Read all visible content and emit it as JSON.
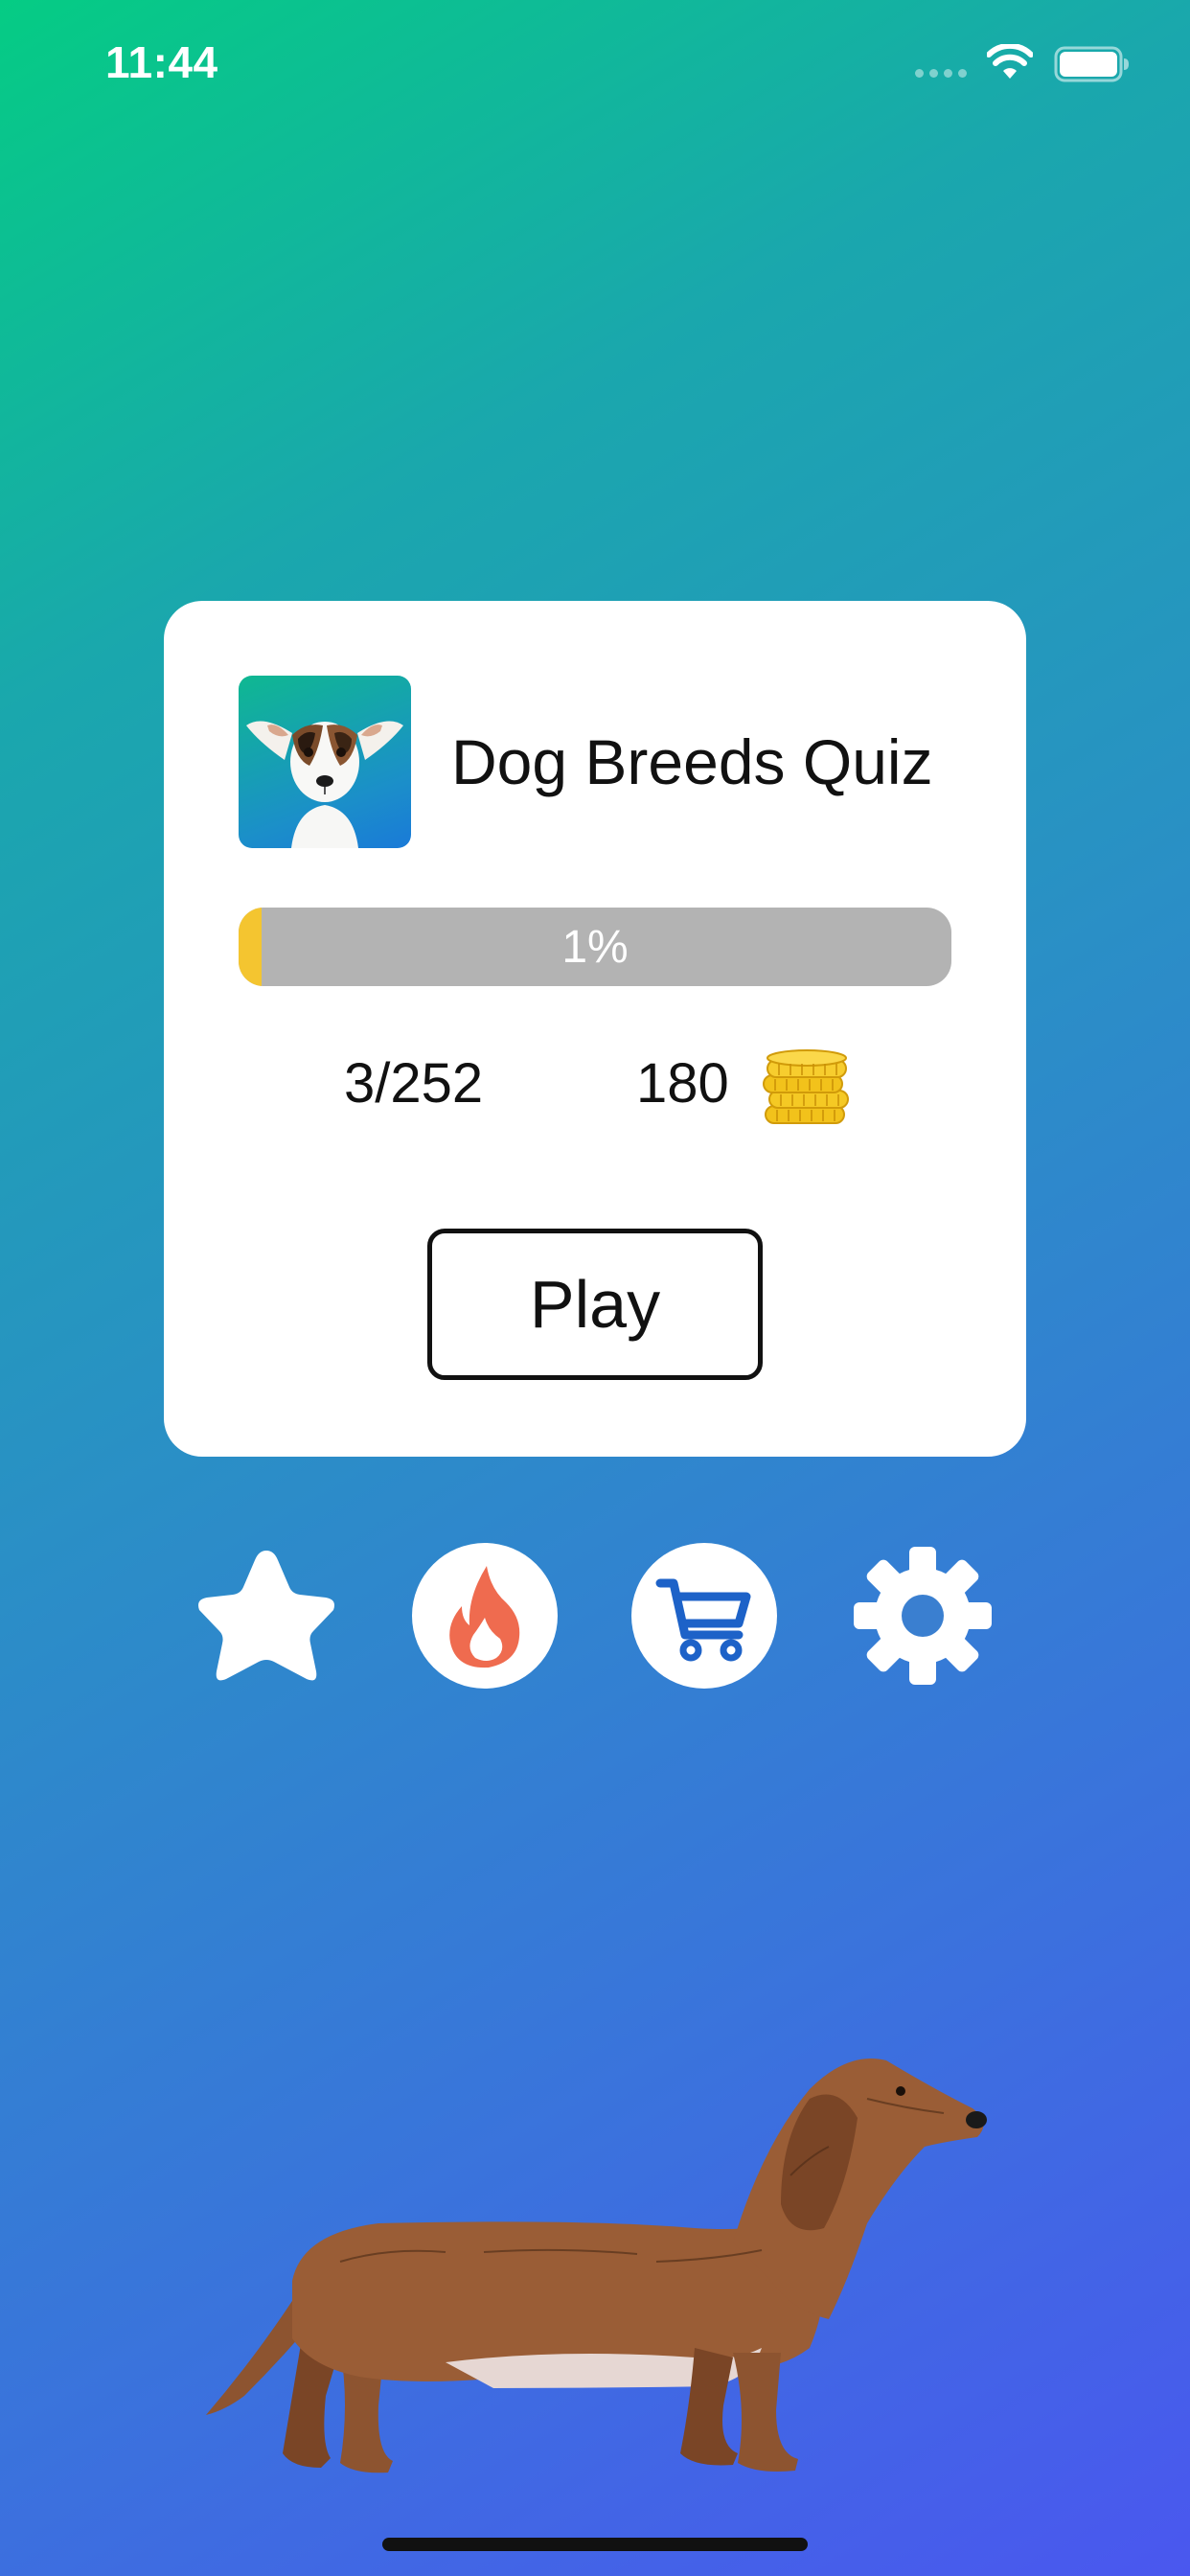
{
  "status_bar": {
    "time": "11:44"
  },
  "card": {
    "title": "Dog Breeds Quiz",
    "progress": {
      "label": "1%",
      "fraction": 0.01
    },
    "answered_count": "3/252",
    "coins": "180",
    "play_label": "Play"
  },
  "icons": {
    "app_icon": "dog-portrait-icon",
    "coins": "coin-stack-icon",
    "favorites": "star-icon",
    "hot": "flame-icon",
    "shop": "shopping-cart-icon",
    "settings": "gear-icon",
    "illustration": "dachshund-illustration"
  },
  "colors": {
    "gradient_start": "#05cc84",
    "gradient_end": "#4a57ef",
    "progress_fill": "#f4c530",
    "progress_track": "#b3b3b3",
    "flame": "#ef6b4f",
    "cart": "#1d62c8",
    "coin": "#f2c21b"
  }
}
